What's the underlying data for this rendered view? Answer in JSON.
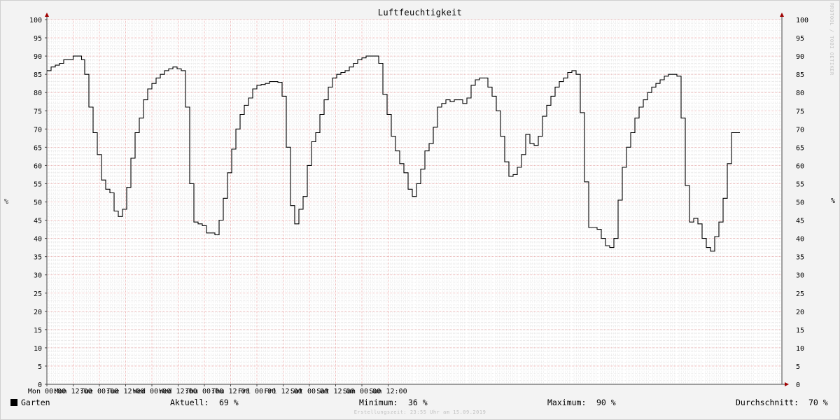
{
  "chart_data": {
    "type": "line",
    "title": "Luftfeuchtigkeit",
    "ylabel": "%",
    "ylim": [
      0,
      100
    ],
    "yticks": [
      0,
      5,
      10,
      15,
      20,
      25,
      30,
      35,
      40,
      45,
      50,
      55,
      60,
      65,
      70,
      75,
      80,
      85,
      90,
      95,
      100
    ],
    "xlim": [
      0,
      14
    ],
    "xtick_labels": [
      "Mon 00:00",
      "Mon 12:00",
      "Tue 00:00",
      "Tue 12:00",
      "Wed 00:00",
      "Wed 12:00",
      "Thu 00:00",
      "Thu 12:00",
      "Fri 00:00",
      "Fri 12:00",
      "Sat 00:00",
      "Sat 12:00",
      "Sun 00:00",
      "Sun 12:00"
    ],
    "grid": true,
    "series": [
      {
        "name": "Garten",
        "color": "#000000",
        "points": [
          [
            0.0,
            86
          ],
          [
            0.08,
            87
          ],
          [
            0.16,
            87.5
          ],
          [
            0.24,
            88
          ],
          [
            0.32,
            89
          ],
          [
            0.4,
            89
          ],
          [
            0.5,
            90
          ],
          [
            0.6,
            90
          ],
          [
            0.66,
            89
          ],
          [
            0.72,
            85
          ],
          [
            0.8,
            76
          ],
          [
            0.88,
            69
          ],
          [
            0.96,
            63
          ],
          [
            1.04,
            56
          ],
          [
            1.12,
            53.5
          ],
          [
            1.2,
            52.5
          ],
          [
            1.28,
            47.5
          ],
          [
            1.36,
            46
          ],
          [
            1.44,
            48
          ],
          [
            1.52,
            54
          ],
          [
            1.6,
            62
          ],
          [
            1.68,
            69
          ],
          [
            1.76,
            73
          ],
          [
            1.84,
            78
          ],
          [
            1.92,
            81
          ],
          [
            2.0,
            82.5
          ],
          [
            2.08,
            84
          ],
          [
            2.16,
            85
          ],
          [
            2.24,
            86
          ],
          [
            2.32,
            86.5
          ],
          [
            2.4,
            87
          ],
          [
            2.48,
            86.5
          ],
          [
            2.56,
            86
          ],
          [
            2.64,
            76
          ],
          [
            2.72,
            55
          ],
          [
            2.8,
            44.5
          ],
          [
            2.88,
            44
          ],
          [
            2.96,
            43.5
          ],
          [
            3.04,
            41.5
          ],
          [
            3.12,
            41.5
          ],
          [
            3.2,
            41
          ],
          [
            3.28,
            45
          ],
          [
            3.36,
            51
          ],
          [
            3.44,
            58
          ],
          [
            3.52,
            64.5
          ],
          [
            3.6,
            70
          ],
          [
            3.68,
            74
          ],
          [
            3.76,
            76.5
          ],
          [
            3.84,
            78.5
          ],
          [
            3.92,
            81
          ],
          [
            4.0,
            82
          ],
          [
            4.08,
            82.2
          ],
          [
            4.16,
            82.5
          ],
          [
            4.24,
            83
          ],
          [
            4.32,
            83
          ],
          [
            4.4,
            82.8
          ],
          [
            4.48,
            79
          ],
          [
            4.56,
            65
          ],
          [
            4.64,
            49
          ],
          [
            4.72,
            44
          ],
          [
            4.8,
            48
          ],
          [
            4.88,
            51.5
          ],
          [
            4.96,
            60
          ],
          [
            5.04,
            66.5
          ],
          [
            5.12,
            69
          ],
          [
            5.2,
            74
          ],
          [
            5.28,
            78
          ],
          [
            5.36,
            81.5
          ],
          [
            5.44,
            84
          ],
          [
            5.52,
            85
          ],
          [
            5.6,
            85.5
          ],
          [
            5.68,
            86
          ],
          [
            5.76,
            87
          ],
          [
            5.84,
            88
          ],
          [
            5.92,
            89
          ],
          [
            6.0,
            89.5
          ],
          [
            6.08,
            90
          ],
          [
            6.16,
            90
          ],
          [
            6.24,
            90
          ],
          [
            6.32,
            88
          ],
          [
            6.4,
            79.5
          ],
          [
            6.48,
            74
          ],
          [
            6.56,
            68
          ],
          [
            6.64,
            64
          ],
          [
            6.72,
            60.5
          ],
          [
            6.8,
            58
          ],
          [
            6.88,
            53.5
          ],
          [
            6.96,
            51.5
          ],
          [
            7.04,
            55
          ],
          [
            7.12,
            59
          ],
          [
            7.2,
            64
          ],
          [
            7.28,
            66
          ],
          [
            7.36,
            70.5
          ],
          [
            7.44,
            76
          ],
          [
            7.52,
            77
          ],
          [
            7.6,
            78
          ],
          [
            7.68,
            77.5
          ],
          [
            7.76,
            78
          ],
          [
            7.84,
            78
          ],
          [
            7.92,
            77
          ],
          [
            8.0,
            78.5
          ],
          [
            8.08,
            82
          ],
          [
            8.16,
            83.5
          ],
          [
            8.24,
            84
          ],
          [
            8.32,
            84
          ],
          [
            8.4,
            81.5
          ],
          [
            8.48,
            79
          ],
          [
            8.56,
            75
          ],
          [
            8.64,
            68
          ],
          [
            8.72,
            61
          ],
          [
            8.8,
            57
          ],
          [
            8.88,
            57.5
          ],
          [
            8.96,
            59.5
          ],
          [
            9.04,
            63
          ],
          [
            9.12,
            68.5
          ],
          [
            9.2,
            66
          ],
          [
            9.28,
            65.5
          ],
          [
            9.36,
            68
          ],
          [
            9.44,
            73.5
          ],
          [
            9.52,
            76.5
          ],
          [
            9.6,
            79
          ],
          [
            9.68,
            81.5
          ],
          [
            9.76,
            83
          ],
          [
            9.84,
            84
          ],
          [
            9.92,
            85.5
          ],
          [
            10.0,
            86
          ],
          [
            10.08,
            85
          ],
          [
            10.16,
            74.5
          ],
          [
            10.24,
            55.5
          ],
          [
            10.32,
            43
          ],
          [
            10.4,
            43
          ],
          [
            10.48,
            42.5
          ],
          [
            10.56,
            40
          ],
          [
            10.64,
            38
          ],
          [
            10.72,
            37.5
          ],
          [
            10.8,
            40
          ],
          [
            10.88,
            50.5
          ],
          [
            10.96,
            59.5
          ],
          [
            11.04,
            65
          ],
          [
            11.12,
            69
          ],
          [
            11.2,
            73
          ],
          [
            11.28,
            76
          ],
          [
            11.36,
            78
          ],
          [
            11.44,
            80
          ],
          [
            11.52,
            81.5
          ],
          [
            11.6,
            82.5
          ],
          [
            11.68,
            83.5
          ],
          [
            11.76,
            84.5
          ],
          [
            11.84,
            85
          ],
          [
            11.92,
            85
          ],
          [
            12.0,
            84.5
          ],
          [
            12.08,
            73
          ],
          [
            12.16,
            54.5
          ],
          [
            12.24,
            44.5
          ],
          [
            12.32,
            45.5
          ],
          [
            12.4,
            44
          ],
          [
            12.48,
            40
          ],
          [
            12.56,
            37.5
          ],
          [
            12.64,
            36.5
          ],
          [
            12.72,
            40.5
          ],
          [
            12.8,
            44.5
          ],
          [
            12.88,
            51
          ],
          [
            12.96,
            60.5
          ],
          [
            13.04,
            69
          ],
          [
            13.12,
            69
          ]
        ]
      }
    ],
    "legend": {
      "label": "Garten",
      "stats": [
        {
          "label": "Aktuell:",
          "value": "69 %"
        },
        {
          "label": "Minimum:",
          "value": "36 %"
        },
        {
          "label": "Maximum:",
          "value": "90 %"
        },
        {
          "label": "Durchschnitt:",
          "value": "70 %"
        }
      ]
    }
  },
  "credits": {
    "side": "RRDTOOL / TOBI OETIKER",
    "bottom": "Erstellungszeit: 23:55 Uhr am 15.09.2019"
  }
}
